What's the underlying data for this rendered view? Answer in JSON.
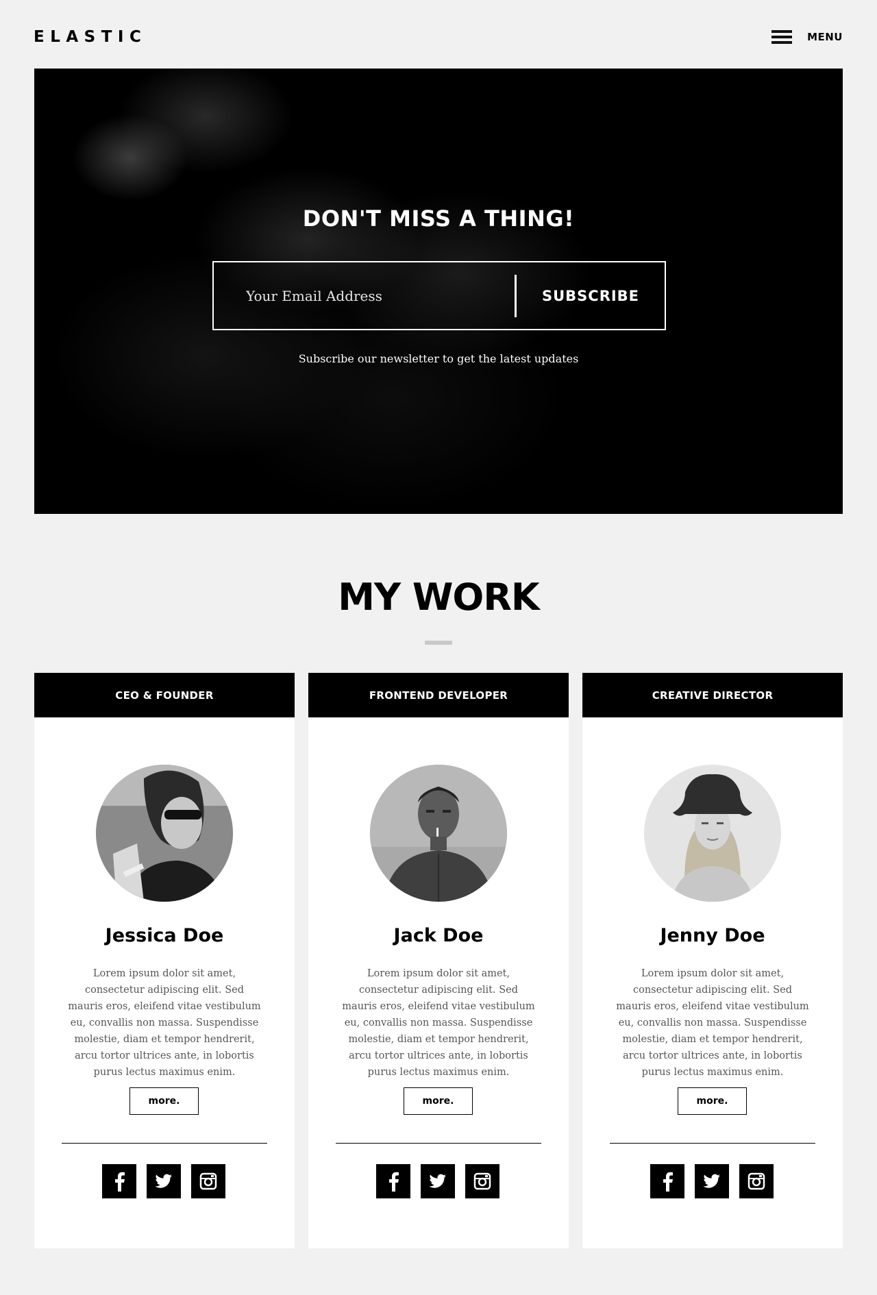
{
  "header": {
    "logo": "ELASTIC",
    "menu_label": "MENU"
  },
  "hero": {
    "title": "DON'T MISS A THING!",
    "email_placeholder": "Your Email Address",
    "subscribe_label": "SUBSCRIBE",
    "note": "Subscribe our newsletter to get the latest updates"
  },
  "work": {
    "title": "MY WORK",
    "members": [
      {
        "role": "CEO & FOUNDER",
        "name": "Jessica Doe",
        "bio": "Lorem ipsum dolor sit amet, consectetur adipiscing elit. Sed mauris eros, eleifend vitae vestibulum eu, convallis non massa. Suspendisse molestie, diam et tempor hendrerit, arcu tortor ultrices ante, in lobortis purus lectus maximus enim.",
        "more_label": "more."
      },
      {
        "role": "FRONTEND DEVELOPER",
        "name": "Jack Doe",
        "bio": "Lorem ipsum dolor sit amet, consectetur adipiscing elit. Sed mauris eros, eleifend vitae vestibulum eu, convallis non massa. Suspendisse molestie, diam et tempor hendrerit, arcu tortor ultrices ante, in lobortis purus lectus maximus enim.",
        "more_label": "more."
      },
      {
        "role": "CREATIVE DIRECTOR",
        "name": "Jenny Doe",
        "bio": "Lorem ipsum dolor sit amet, consectetur adipiscing elit. Sed mauris eros, eleifend vitae vestibulum eu, convallis non massa. Suspendisse molestie, diam et tempor hendrerit, arcu tortor ultrices ante, in lobortis purus lectus maximus enim.",
        "more_label": "more."
      }
    ],
    "social_icons": [
      "facebook-icon",
      "twitter-icon",
      "instagram-icon"
    ]
  },
  "colors": {
    "background": "#f1f1f1",
    "primary": "#000000",
    "card": "#ffffff",
    "divider_accent": "#c9c9c9"
  }
}
